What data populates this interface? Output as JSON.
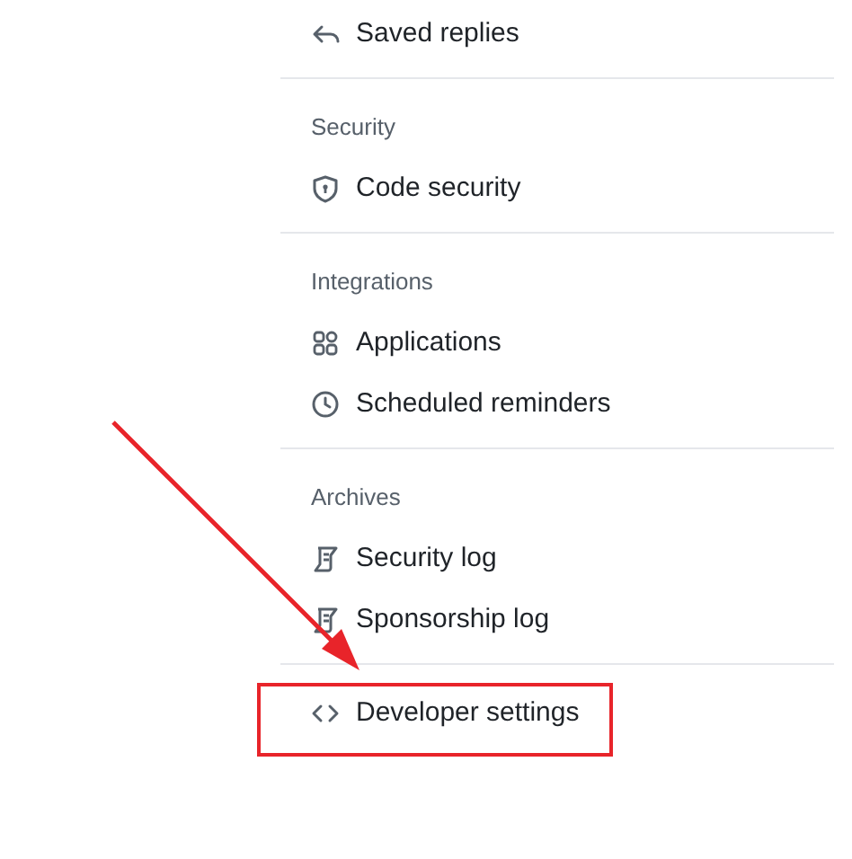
{
  "sections": [
    {
      "items": [
        {
          "label": "Saved replies",
          "kind": "reply"
        }
      ]
    },
    {
      "heading": "Security",
      "items": [
        {
          "label": "Code security",
          "kind": "shield"
        }
      ]
    },
    {
      "heading": "Integrations",
      "items": [
        {
          "label": "Applications",
          "kind": "apps"
        },
        {
          "label": "Scheduled reminders",
          "kind": "clock"
        }
      ]
    },
    {
      "heading": "Archives",
      "items": [
        {
          "label": "Security log",
          "kind": "log"
        },
        {
          "label": "Sponsorship log",
          "kind": "log"
        }
      ]
    },
    {
      "items": [
        {
          "label": "Developer settings",
          "kind": "code",
          "highlighted": true
        }
      ]
    }
  ]
}
